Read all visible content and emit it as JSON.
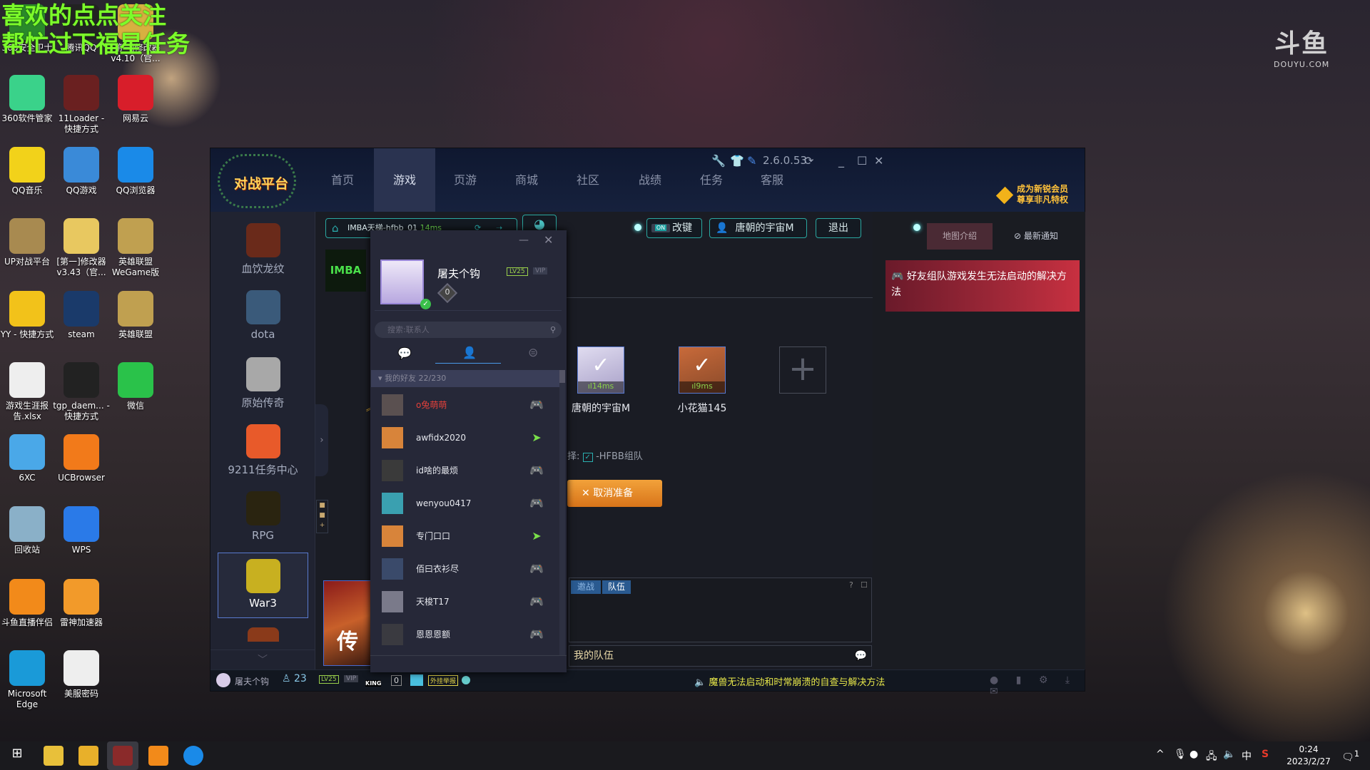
{
  "overlay": {
    "line1": "喜欢的点点关注",
    "line2": "帮忙过下福星任务"
  },
  "watermark": {
    "logo": "斗鱼",
    "site": "DOUYU.COM"
  },
  "desktop": [
    {
      "label": "360安全卫士",
      "color": "#2a8a2a"
    },
    {
      "label": "腾讯QQ",
      "color": "#222"
    },
    {
      "label": "[第一]修改器 v4.10（官...",
      "color": "#d8b040"
    },
    {
      "label": "360软件管家",
      "color": "#3ad28a"
    },
    {
      "label": "11Loader - 快捷方式",
      "color": "#6a2020"
    },
    {
      "label": "网易云",
      "color": "#d81e2a"
    },
    {
      "label": "QQ音乐",
      "color": "#f2d21a"
    },
    {
      "label": "QQ游戏",
      "color": "#3a8ad8"
    },
    {
      "label": "QQ浏览器",
      "color": "#1a8ae8"
    },
    {
      "label": "UP对战平台",
      "color": "#a88a50"
    },
    {
      "label": "[第一]修改器 v3.43（官...",
      "color": "#e8c860"
    },
    {
      "label": "英雄联盟 WeGame版",
      "color": "#c0a050"
    },
    {
      "label": "YY - 快捷方式",
      "color": "#f2c21a"
    },
    {
      "label": "steam",
      "color": "#1a3a6a"
    },
    {
      "label": "英雄联盟",
      "color": "#c0a050"
    },
    {
      "label": "游戏生涯报告.xlsx",
      "color": "#eee"
    },
    {
      "label": "tgp_daem... - 快捷方式",
      "color": "#222"
    },
    {
      "label": "微信",
      "color": "#2ac24a"
    },
    {
      "label": "6XC",
      "color": "#4aa8e8"
    },
    {
      "label": "UCBrowser",
      "color": "#f27a1a"
    },
    {
      "label": "回收站",
      "color": "#8ab0c8"
    },
    {
      "label": "WPS",
      "color": "#2a7ae8"
    },
    {
      "label": "斗鱼直播伴侣",
      "color": "#f28a1a"
    },
    {
      "label": "雷神加速器",
      "color": "#f29a2a"
    },
    {
      "label": "Microsoft Edge",
      "color": "#1a9ad8"
    },
    {
      "label": "美服密码",
      "color": "#eee"
    }
  ],
  "app": {
    "logo": "对战平台",
    "nav": [
      "首页",
      "游戏",
      "页游",
      "商城",
      "社区",
      "战绩",
      "任务",
      "客服"
    ],
    "active_nav": "游戏",
    "version": "2.6.0.53",
    "vip_promo": {
      "line1": "成为新锐会员",
      "line2": "尊享非凡特权"
    },
    "sidebar": [
      "血饮龙纹",
      "dota",
      "原始传奇",
      "9211任务中心",
      "RPG",
      "War3"
    ],
    "selected_game": "War3",
    "room": {
      "name": "IMBA天梯-hfbb_01",
      "ping": "14ms"
    },
    "thumb": "IMBA",
    "toggle": "ON",
    "keymap_label": "改键",
    "user_button": "唐朝的宇宙M",
    "exit_label": "退出",
    "right_tabs": [
      "地图介绍",
      "最新通知"
    ],
    "notice": "好友组队游戏发生无法启动的解决方法",
    "team": [
      {
        "name": "唐朝的宇宙M",
        "ping": "14ms",
        "ready": true
      },
      {
        "name": "小花猫145",
        "ping": "9ms",
        "ready": true
      }
    ],
    "option": {
      "prefix": "择:",
      "label": "-HFBB组队",
      "checked": true
    },
    "cancel_ready": "取消准备",
    "chat_tabs": [
      "邀战",
      "队伍"
    ],
    "chat_help": "?",
    "chat_input": "我的队伍",
    "banner": "传",
    "bottom": {
      "username": "屠夫个钩",
      "friends": "23",
      "level": "LV25",
      "vip": "VIP",
      "king": "KING",
      "diamond": "0",
      "badge": "外挂举报",
      "announcement": "魔兽无法启动和时常崩溃的自查与解决方法"
    }
  },
  "friends_panel": {
    "username": "屠夫个钩",
    "diamond": "0",
    "level": "LV25",
    "vip": "VIP",
    "search_placeholder": "搜索:联系人",
    "group": "我的好友 22/230",
    "friends": [
      {
        "name": "o兔萌萌",
        "status": "in-game",
        "color": "#e2403a"
      },
      {
        "name": "awfidx2020",
        "status": "online",
        "color": "#e6e8ee"
      },
      {
        "name": "id啥的最烦",
        "status": "in-game",
        "color": "#e6e8ee"
      },
      {
        "name": "wenyou0417",
        "status": "in-game",
        "color": "#e6e8ee"
      },
      {
        "name": "专门口口",
        "status": "online",
        "color": "#e6e8ee"
      },
      {
        "name": "佰曰衣衫尽",
        "status": "in-game",
        "color": "#e6e8ee"
      },
      {
        "name": "天梭T17",
        "status": "in-game",
        "color": "#e6e8ee"
      },
      {
        "name": "恩恩恩额",
        "status": "in-game",
        "color": "#e6e8ee"
      }
    ]
  },
  "tray": {
    "ime": "中",
    "time": "0:24",
    "date": "2023/2/27",
    "notifications": "1"
  },
  "colors": {
    "accent": "#2aa7a0",
    "notice": "#c0283a",
    "ready": "#e8902a",
    "overlay": "#7CFC2A"
  }
}
